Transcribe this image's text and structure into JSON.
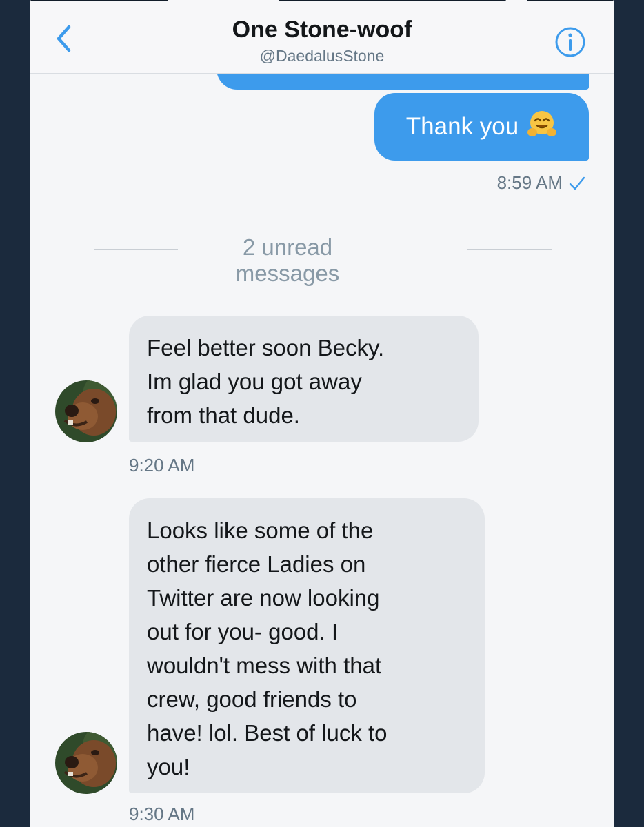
{
  "header": {
    "title": "One Stone-woof",
    "handle": "@DaedalusStone"
  },
  "messages": {
    "outgoing": [
      {
        "text": "Thank you",
        "emoji": "hugging-face",
        "time": "8:59 AM",
        "status": "sent-check"
      }
    ],
    "divider": "2 unread messages",
    "incoming": [
      {
        "lines": [
          "Feel better soon Becky.",
          "Im glad you got away",
          "from that dude."
        ],
        "time": "9:20 AM"
      },
      {
        "lines": [
          "Looks like some of the",
          "other fierce Ladies on",
          "Twitter are now looking",
          "out for you- good. I",
          "wouldn't mess with that",
          "crew, good friends to",
          "have! lol. Best of luck to",
          "you!"
        ],
        "time": "9:30 AM"
      }
    ]
  },
  "icons": {
    "back": "chevron-left-icon",
    "info": "info-icon",
    "check": "checkmark-icon"
  },
  "colors": {
    "accent": "#3d9bec",
    "incoming_bubble": "#e3e6ea",
    "text_secondary": "#657786",
    "frame": "#1b2a3d"
  }
}
